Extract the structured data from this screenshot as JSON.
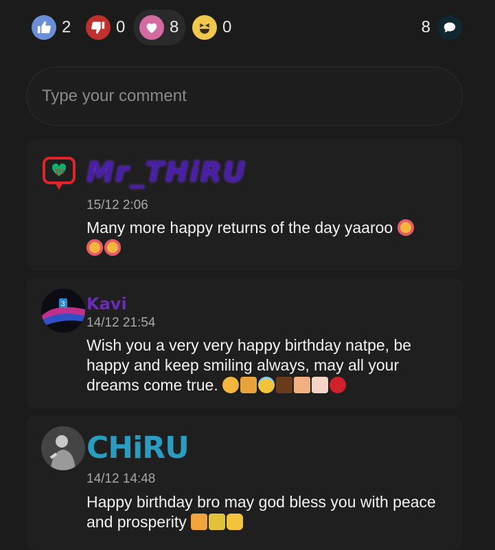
{
  "reactions": {
    "like": {
      "count": "2",
      "icon": "thumbs-up-icon"
    },
    "dislike": {
      "count": "0",
      "icon": "thumbs-down-icon"
    },
    "love": {
      "count": "8",
      "icon": "heart-icon"
    },
    "haha": {
      "count": "0",
      "icon": "laughing-face-icon"
    },
    "comments": {
      "count": "8",
      "icon": "chat-bubble-icon"
    }
  },
  "comment_input": {
    "placeholder": "Type your comment"
  },
  "comments": [
    {
      "author": "Mr_THiRU",
      "time": "15/12 2:06",
      "text": "Many more happy returns of the day yaaroo",
      "emojis": [
        "smiling-face-hearts",
        "smiling-face-hearts",
        "smiling-face-hearts"
      ]
    },
    {
      "author": "Kavi",
      "time": "14/12 21:54",
      "text": "Wish you a very very happy birthday natpe, be happy and keep smiling always, may all your dreams come true.",
      "emojis": [
        "hugging-face",
        "bouquet",
        "halo-face",
        "chocolate",
        "cake-slice",
        "birthday-cake",
        "rose"
      ]
    },
    {
      "author": "CHiRU",
      "time": "14/12 14:48",
      "text": "Happy birthday bro  may god bless you with peace and prosperity",
      "emojis": [
        "party-popper",
        "confetti",
        "victory-hand"
      ]
    }
  ],
  "colors": {
    "background": "#1b1b1b",
    "card": "#1f1f1f",
    "like": "#6b8fd6",
    "dislike": "#c0302c",
    "love": "#d56aa2",
    "haha": "#f2c84c",
    "name_thiru": "#4a1fa8",
    "name_kavi": "#6a2bb8",
    "name_chiru": "#2a9cc0"
  }
}
